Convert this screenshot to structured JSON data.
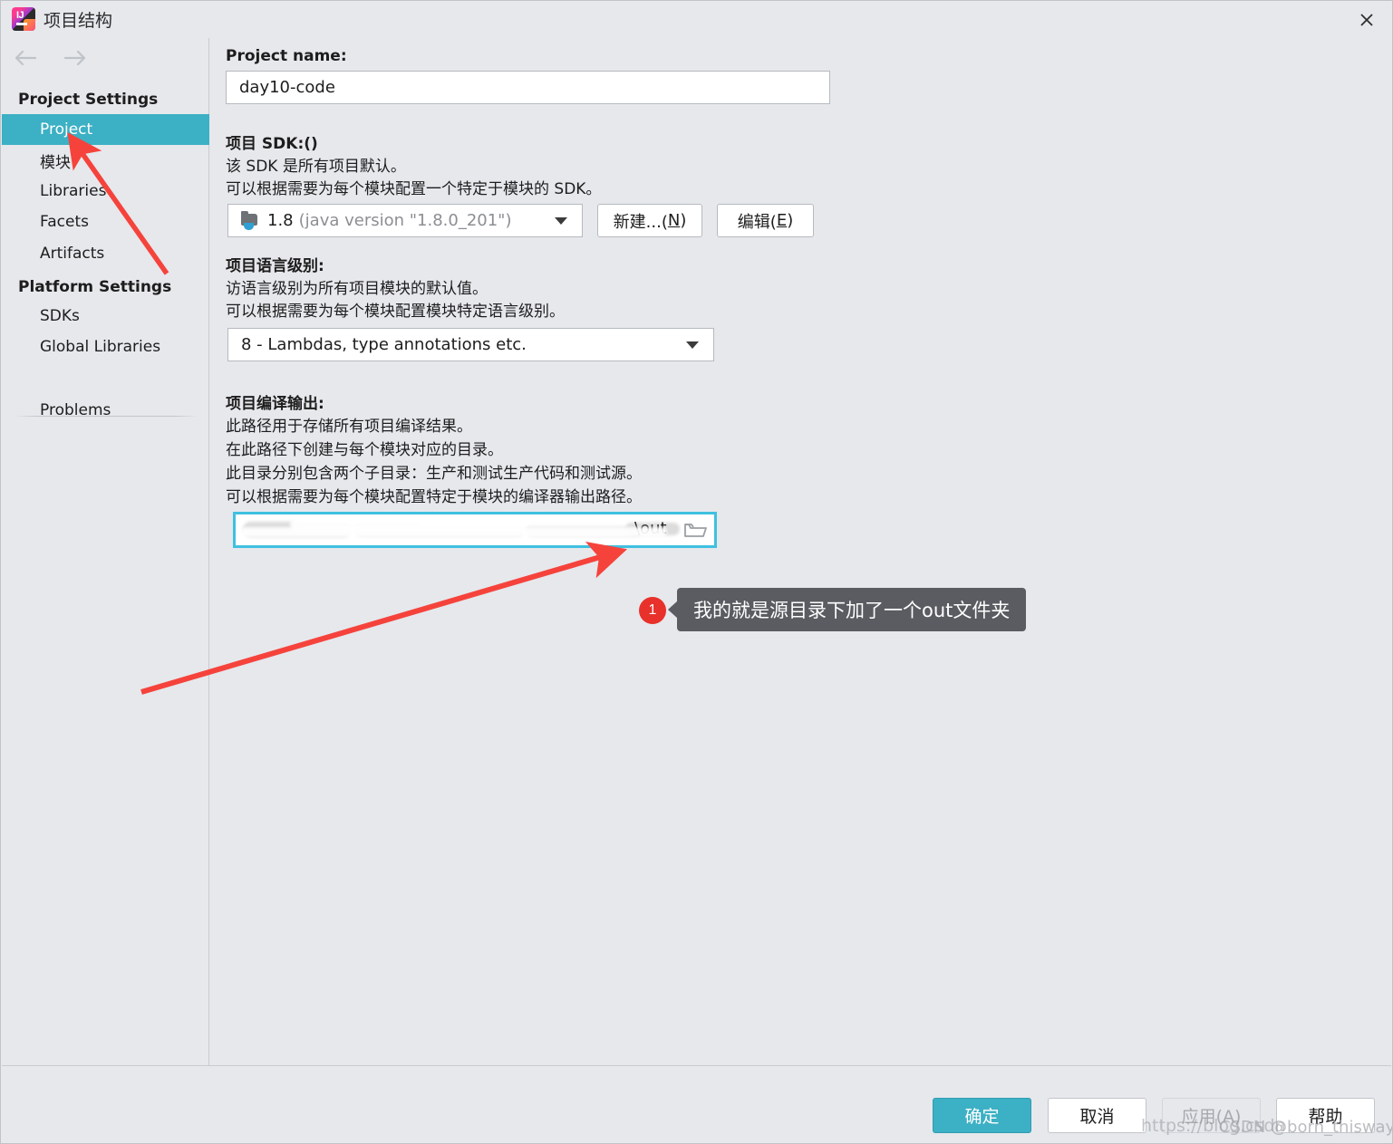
{
  "window": {
    "title": "项目结构",
    "logo_icon": "intellij-idea-logo",
    "close_icon": "close-icon",
    "back_icon": "arrow-left-icon",
    "forward_icon": "arrow-right-icon"
  },
  "sidebar": {
    "groups": [
      {
        "header": "Project Settings",
        "items": [
          {
            "label": "Project",
            "selected": true
          },
          {
            "label": "模块",
            "selected": false
          },
          {
            "label": "Libraries",
            "selected": false
          },
          {
            "label": "Facets",
            "selected": false
          },
          {
            "label": "Artifacts",
            "selected": false
          }
        ]
      },
      {
        "header": "Platform Settings",
        "items": [
          {
            "label": "SDKs",
            "selected": false
          },
          {
            "label": "Global Libraries",
            "selected": false
          }
        ]
      }
    ],
    "problems": {
      "label": "Problems"
    }
  },
  "main": {
    "project_name": {
      "label": "Project name:",
      "value": "day10-code"
    },
    "sdk": {
      "label": "项目 SDK:()",
      "desc1": "该 SDK 是所有项目默认。",
      "desc2": "可以根据需要为每个模块配置一个特定于模块的 SDK。",
      "icon": "jdk-folder-icon",
      "version": "1.8",
      "detail": "(java version \"1.8.0_201\")",
      "caret_icon": "chevron-down-icon",
      "new_button": {
        "pre": "新建...(",
        "key": "N",
        "post": ")"
      },
      "edit_button": {
        "pre": "编辑(",
        "key": "E",
        "post": ")"
      }
    },
    "language_level": {
      "label": "项目语言级别:",
      "desc1": "访语言级别为所有项目模块的默认值。",
      "desc2": "可以根据需要为每个模块配置模块特定语言级别。",
      "value": "8 - Lambdas, type annotations etc.",
      "caret_icon": "chevron-down-icon"
    },
    "compiler_output": {
      "label": "项目编译输出:",
      "desc1": "此路径用于存储所有项目编译结果。",
      "desc2": "在此路径下创建与每个模块对应的目录。",
      "desc3": "此目录分别包含两个子目录：生产和测试生产代码和测试源。",
      "desc4": "可以根据需要为每个模块配置特定于模块的编译器输出路径。",
      "value": "\\out",
      "browse_icon": "folder-open-icon"
    }
  },
  "annotation": {
    "badge_number": "1",
    "text": "我的就是源目录下加了一个out文件夹",
    "arrow_color": "#f5433c",
    "callout_bg": "#5a5c61"
  },
  "footer": {
    "ok": "确定",
    "cancel": "取消",
    "apply": "应用(A)",
    "help": "帮助"
  },
  "watermark": {
    "url": "https://blog.csdn",
    "author": "CSDN @born_thisway"
  },
  "colors": {
    "accent_teal": "#3cb0c4",
    "focus_cyan": "#3fc0e0",
    "annotation_red": "#e8312a",
    "window_bg": "#e6e8ec"
  }
}
